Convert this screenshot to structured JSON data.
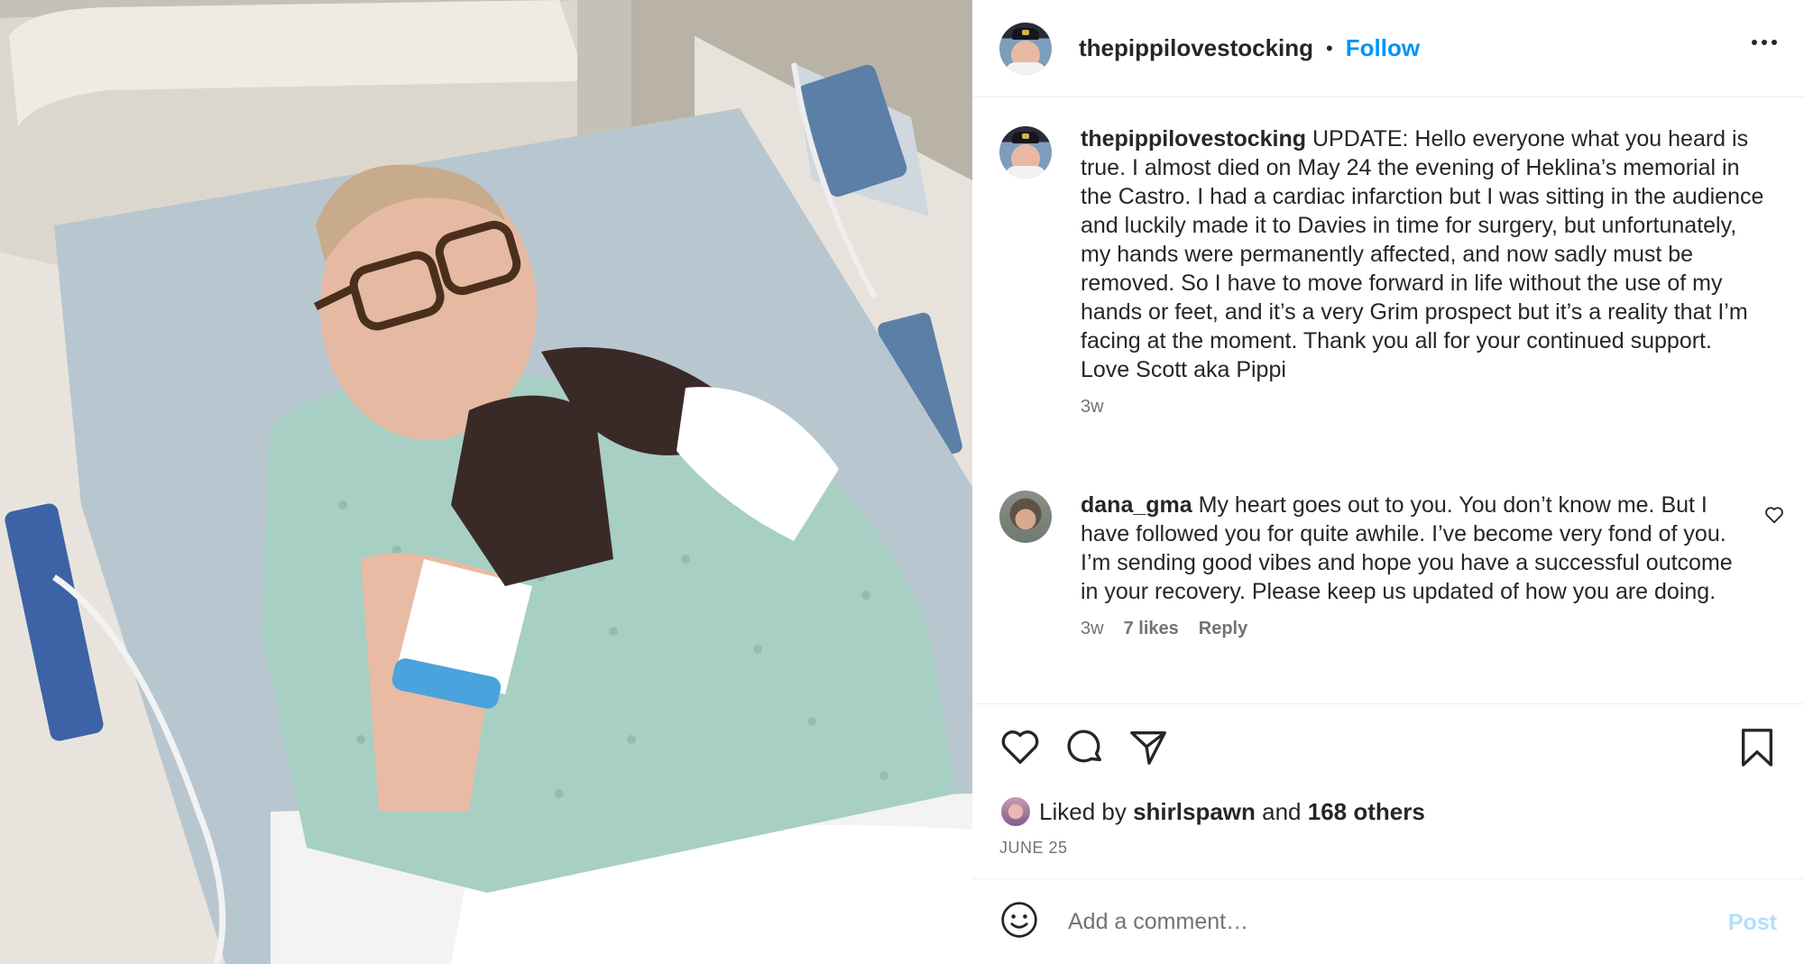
{
  "post": {
    "author": "thepippilovestocking",
    "follow_label": "Follow",
    "separator": "•"
  },
  "caption": {
    "username": "thepippilovestocking",
    "text": "UPDATE: Hello everyone what you heard is true. I almost died on May 24 the evening of Heklina’s memorial in the Castro. I had a cardiac infarction but I was sitting in the audience and luckily made it to Davies in time for surgery, but unfortunately, my hands were permanently affected, and now sadly must be removed. So I have to move forward in life without the use of my hands or feet, and it’s a very Grim prospect but it’s a reality that I’m facing at the moment. Thank you all for your continued support. Love Scott aka Pippi",
    "time": "3w"
  },
  "comment": {
    "username": "dana_gma",
    "text": "My heart goes out to you. You don’t know me. But I have followed you for quite awhile. I’ve become very fond of you. I’m sending good vibes and hope you have a successful outcome in your recovery. Please keep us updated of how you are doing.",
    "time": "3w",
    "likes": "7 likes",
    "reply_label": "Reply"
  },
  "likes": {
    "prefix": "Liked by",
    "user": "shirlspawn",
    "conjunction": "and",
    "others": "168 others"
  },
  "date": "JUNE 25",
  "add_comment": {
    "placeholder": "Add a comment…",
    "post_label": "Post"
  },
  "colors": {
    "accent": "#0095f6",
    "post_disabled": "#b2dffc",
    "text": "#262626",
    "secondary": "#737373"
  },
  "icons": {
    "more": "more-options-icon",
    "like": "heart-icon",
    "comment": "comment-icon",
    "share": "share-icon",
    "save": "bookmark-icon",
    "emoji": "emoji-icon"
  }
}
